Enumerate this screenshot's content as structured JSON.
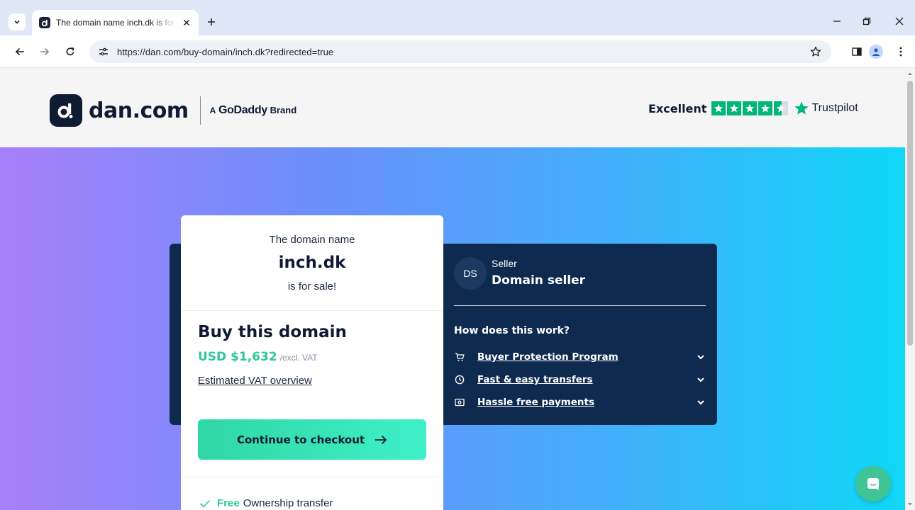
{
  "browser": {
    "tab_title": "The domain name inch.dk is for sale!",
    "url": "https://dan.com/buy-domain/inch.dk?redirected=true"
  },
  "header": {
    "logo_text": "dan.com",
    "godaddy_a": "A",
    "godaddy_name": "GoDaddy",
    "godaddy_brand": "Brand",
    "trustpilot_rating": "Excellent",
    "trustpilot_name": "Trustpilot",
    "star_color": "#00b67a"
  },
  "sale_card": {
    "line1": "The domain name",
    "domain": "inch.dk",
    "line3": "is for sale!",
    "buy_heading": "Buy this domain",
    "price": "USD $1,632",
    "price_note": "/excl. VAT",
    "vat_link": "Estimated VAT overview",
    "cta_label": "Continue to checkout",
    "perk_free": "Free",
    "perk_text": "Ownership transfer"
  },
  "seller_card": {
    "avatar_initials": "DS",
    "label": "Seller",
    "name": "Domain seller",
    "how_title": "How does this work?",
    "items": [
      {
        "icon": "cart-icon",
        "label": "Buyer Protection Program"
      },
      {
        "icon": "clock-icon",
        "label": "Fast & easy transfers"
      },
      {
        "icon": "payment-icon",
        "label": "Hassle free payments"
      }
    ]
  },
  "colors": {
    "accent_green": "#2fc79a",
    "dark_navy": "#0e2a4e"
  }
}
